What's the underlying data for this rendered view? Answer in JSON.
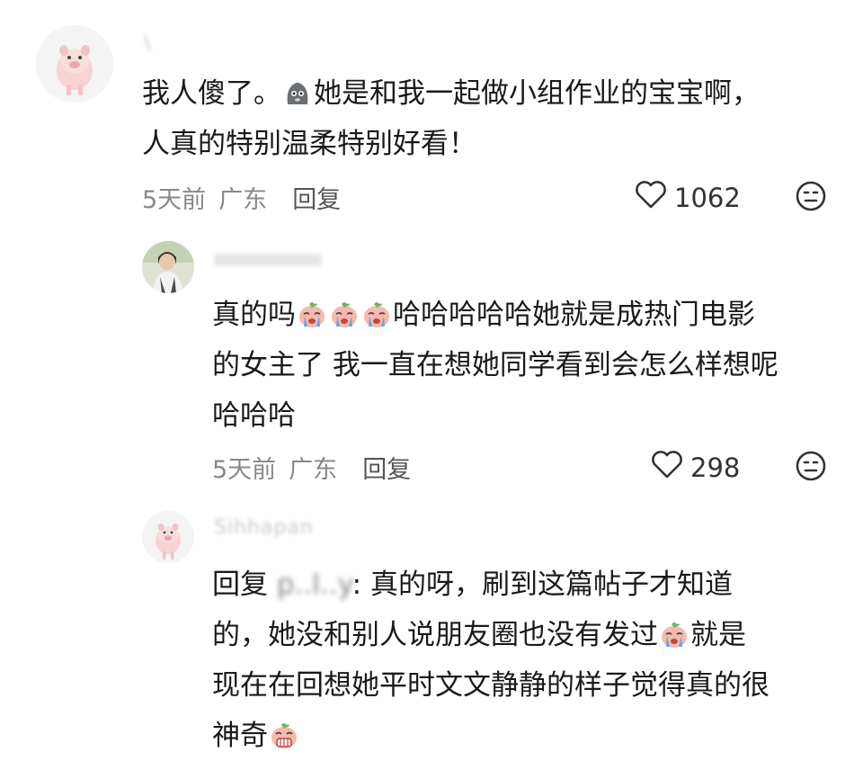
{
  "comments": [
    {
      "username": "\\",
      "text_line1_a": "我人傻了。",
      "emoji_name": "speechless-emoji",
      "text_line1_b": "她是和我一起做小组作业的宝宝啊，",
      "text_line2": "人真的特别温柔特别好看！",
      "time": "5天前",
      "location": "广东",
      "reply_label": "回复",
      "likes": "1062"
    },
    {
      "username": "",
      "text_line1_a": "真的吗",
      "text_line1_b": "哈哈哈哈哈她就是成热门电影",
      "text_line2": "的女主了 我一直在想她同学看到会怎么样想呢",
      "text_line3": "哈哈哈",
      "time": "5天前",
      "location": "广东",
      "reply_label": "回复",
      "likes": "298"
    },
    {
      "username": "Sihhapan",
      "reply_prefix": "回复",
      "reply_to": "p..l..y",
      "text_line1_b": ": 真的呀，刷到这篇帖子才知道",
      "text_line2_a": "的，她没和别人说朋友圈也没有发过",
      "text_line2_b": "就是",
      "text_line3": "现在在回想她平时文文静静的样子觉得真的很",
      "text_line4": "神奇"
    }
  ]
}
